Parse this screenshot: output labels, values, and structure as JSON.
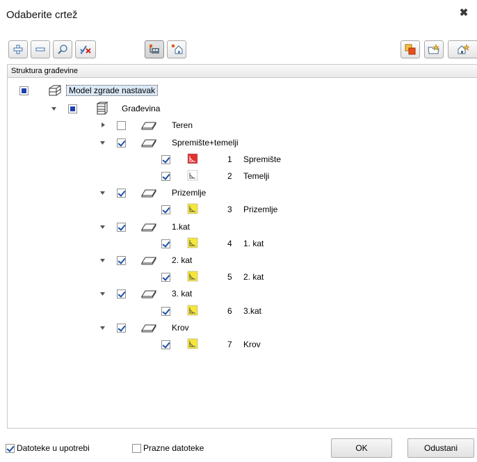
{
  "dialog": {
    "title": "Odaberite crtež",
    "close_symbol": "✖"
  },
  "header": {
    "column_label": "Struktura građevine"
  },
  "tree": {
    "root": {
      "label": "Model zgrade nastavak"
    },
    "building": {
      "label": "Građevina"
    },
    "teren": {
      "label": "Teren"
    },
    "floors": [
      {
        "label": "Spremište+temelji",
        "drawings": [
          {
            "num": "1",
            "label": "Spremište",
            "icon": "red"
          },
          {
            "num": "2",
            "label": "Temelji",
            "icon": "white"
          }
        ]
      },
      {
        "label": "Prizemlje",
        "drawings": [
          {
            "num": "3",
            "label": "Prizemlje",
            "icon": "yellow"
          }
        ]
      },
      {
        "label": "1.kat",
        "drawings": [
          {
            "num": "4",
            "label": "1. kat",
            "icon": "yellow"
          }
        ]
      },
      {
        "label": "2. kat",
        "drawings": [
          {
            "num": "5",
            "label": "2. kat",
            "icon": "yellow"
          }
        ]
      },
      {
        "label": "3. kat",
        "drawings": [
          {
            "num": "6",
            "label": "3.kat",
            "icon": "yellow"
          }
        ]
      },
      {
        "label": "Krov",
        "drawings": [
          {
            "num": "7",
            "label": "Krov",
            "icon": "yellow"
          }
        ]
      }
    ]
  },
  "footer": {
    "files_in_use_label": "Datoteke u upotrebi",
    "empty_files_label": "Prazne datoteke",
    "ok_label": "OK",
    "cancel_label": "Odustani"
  }
}
